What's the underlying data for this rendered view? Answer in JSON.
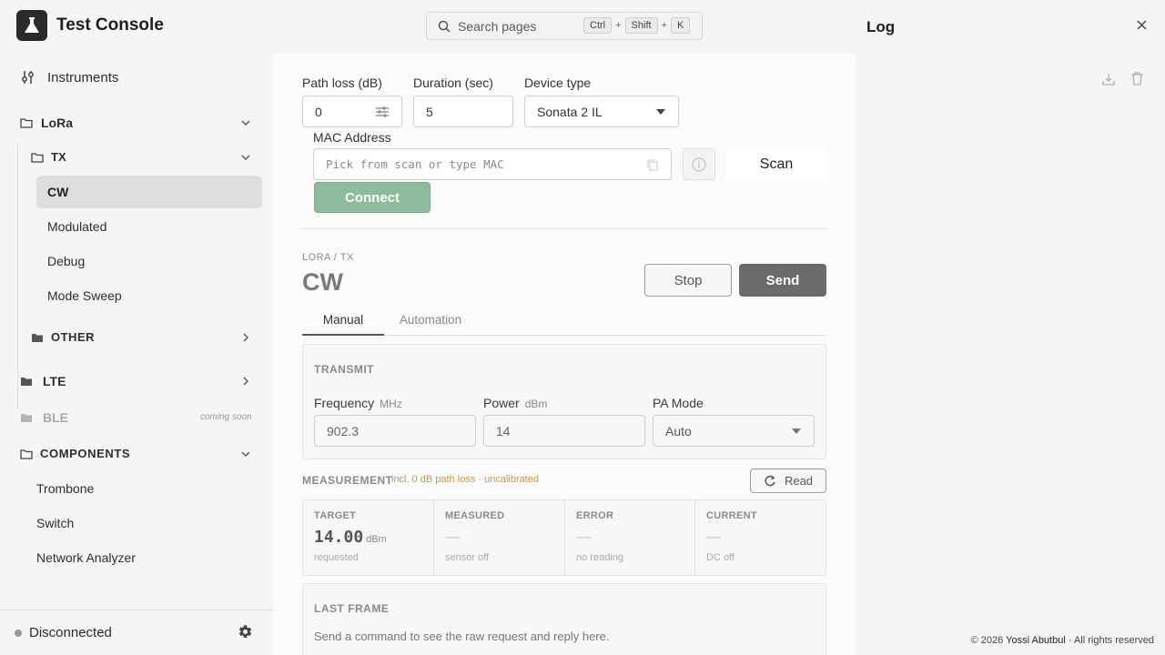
{
  "app": {
    "title": "Test Console"
  },
  "search": {
    "placeholder": "Search pages",
    "keys": [
      "Ctrl",
      "Shift",
      "K"
    ],
    "plus": "+"
  },
  "sidebar": {
    "instruments": "Instruments",
    "lora": "LoRa",
    "tx": "TX",
    "tx_items": [
      "CW",
      "Modulated",
      "Debug",
      "Mode Sweep"
    ],
    "other": "OTHER",
    "lte": "LTE",
    "ble": "BLE",
    "ble_badge": "coming soon",
    "components": "COMPONENTS",
    "component_items": [
      "Trombone",
      "Switch",
      "Network Analyzer"
    ],
    "status": "Disconnected"
  },
  "connection": {
    "path_loss_label": "Path loss (dB)",
    "path_loss_value": "0",
    "duration_label": "Duration (sec)",
    "duration_value": "5",
    "device_type_label": "Device type",
    "device_type_value": "Sonata 2 IL",
    "mac_label": "MAC Address",
    "mac_placeholder": "Pick from scan or type MAC",
    "scan_label": "Scan",
    "connect_label": "Connect"
  },
  "page": {
    "breadcrumb": "LORA / TX",
    "title": "CW",
    "stop_label": "Stop",
    "send_label": "Send",
    "tabs": [
      "Manual",
      "Automation"
    ]
  },
  "transmit": {
    "caption": "TRANSMIT",
    "frequency_label": "Frequency",
    "frequency_unit": "MHz",
    "frequency_value": "902.3",
    "power_label": "Power",
    "power_unit": "dBm",
    "power_value": "14",
    "pa_mode_label": "PA Mode",
    "pa_mode_value": "Auto"
  },
  "measurement": {
    "caption": "MEASUREMENT",
    "note": "incl. 0 dB path loss · uncalibrated",
    "read_label": "Read",
    "metrics": [
      {
        "caption": "TARGET",
        "value": "14.00",
        "unit": "dBm",
        "sub": "requested"
      },
      {
        "caption": "MEASURED",
        "value": "—",
        "sub": "sensor off"
      },
      {
        "caption": "ERROR",
        "value": "—",
        "sub": "no reading"
      },
      {
        "caption": "CURRENT",
        "value": "—",
        "sub": "DC off"
      }
    ]
  },
  "last_frame": {
    "caption": "LAST FRAME",
    "text": "Send a command to see the raw request and reply here."
  },
  "log": {
    "title": "Log",
    "copyright_prefix": "© 2026 ",
    "author": "Yossi Abutbul",
    "copyright_suffix": " · All rights reserved"
  },
  "colors": {
    "connect_bg": "#8cbc9c",
    "send_bg": "#6b6b6b",
    "note": "#c8964a",
    "accent_tab": "#555555"
  }
}
